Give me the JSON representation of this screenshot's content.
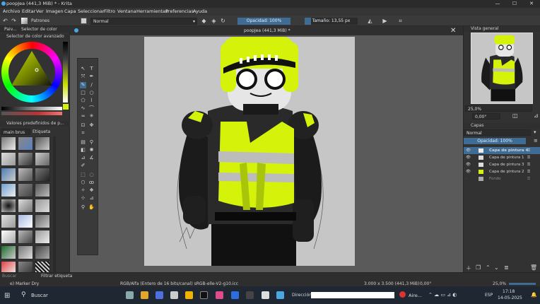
{
  "window": {
    "title": "poopJea (441,3 MiB) * - Krita",
    "minimize": "—",
    "maximize": "☐",
    "close": "✕"
  },
  "menu": [
    "Archivo",
    "Editar",
    "Ver",
    "Imagen",
    "Capa",
    "Seleccionar",
    "Filtro",
    "Ventana",
    "Herramientas",
    "Preferencias",
    "Ayuda"
  ],
  "toolbar": {
    "patterns_label": "Patrones",
    "blend_mode": "Normal",
    "opacity": "Opacidad: 100%",
    "size": "Tamaño: 13,55 px"
  },
  "left_dock": {
    "tab_paint": "Paiv...",
    "tab_selector": "Selector de color avan...",
    "color_selector_title": "Selector de color avanzado",
    "presets_title": "Valores predefinidos de p...",
    "brush_filter": "main brus",
    "tag_label": "Etiqueta",
    "search_placeholder": "Buscar",
    "filter_label": "Filtrar etiqueta"
  },
  "document": {
    "tab_title": "poopJea (441,3 MiB) *"
  },
  "right_dock": {
    "overview_title": "Vista general",
    "zoom": "25,0%",
    "rotation": "0,00°",
    "layers_title": "Capas",
    "blend_mode": "Normal",
    "opacity": "Opacidad: 100%",
    "layers": [
      {
        "name": "Capa de pintura 4",
        "active": true
      },
      {
        "name": "Capa de pintura 1",
        "active": false
      },
      {
        "name": "Capa de pintura 3",
        "active": false
      },
      {
        "name": "Capa de pintura 2",
        "active": false
      },
      {
        "name": "Fondo",
        "active": false
      }
    ]
  },
  "status": {
    "brush": "e) Marker Dry",
    "color_space": "RGB/Alfa (Entero de 16 bits/canal)  sRGB-elle-V2-g10.icc",
    "dims": "3.000 x 3.500 (441,3 MiB)",
    "rotation": "0,00°",
    "zoom": "25,0%"
  },
  "taskbar": {
    "search": "Buscar",
    "address_label": "Dirección",
    "weather": "Aire...",
    "lang": "ESP",
    "time": "17:18",
    "date": "14-05-2025"
  },
  "colors": {
    "accent_blue": "#3f6c95",
    "vest_yellow": "#d4f20a",
    "panel_bg": "#323232"
  }
}
